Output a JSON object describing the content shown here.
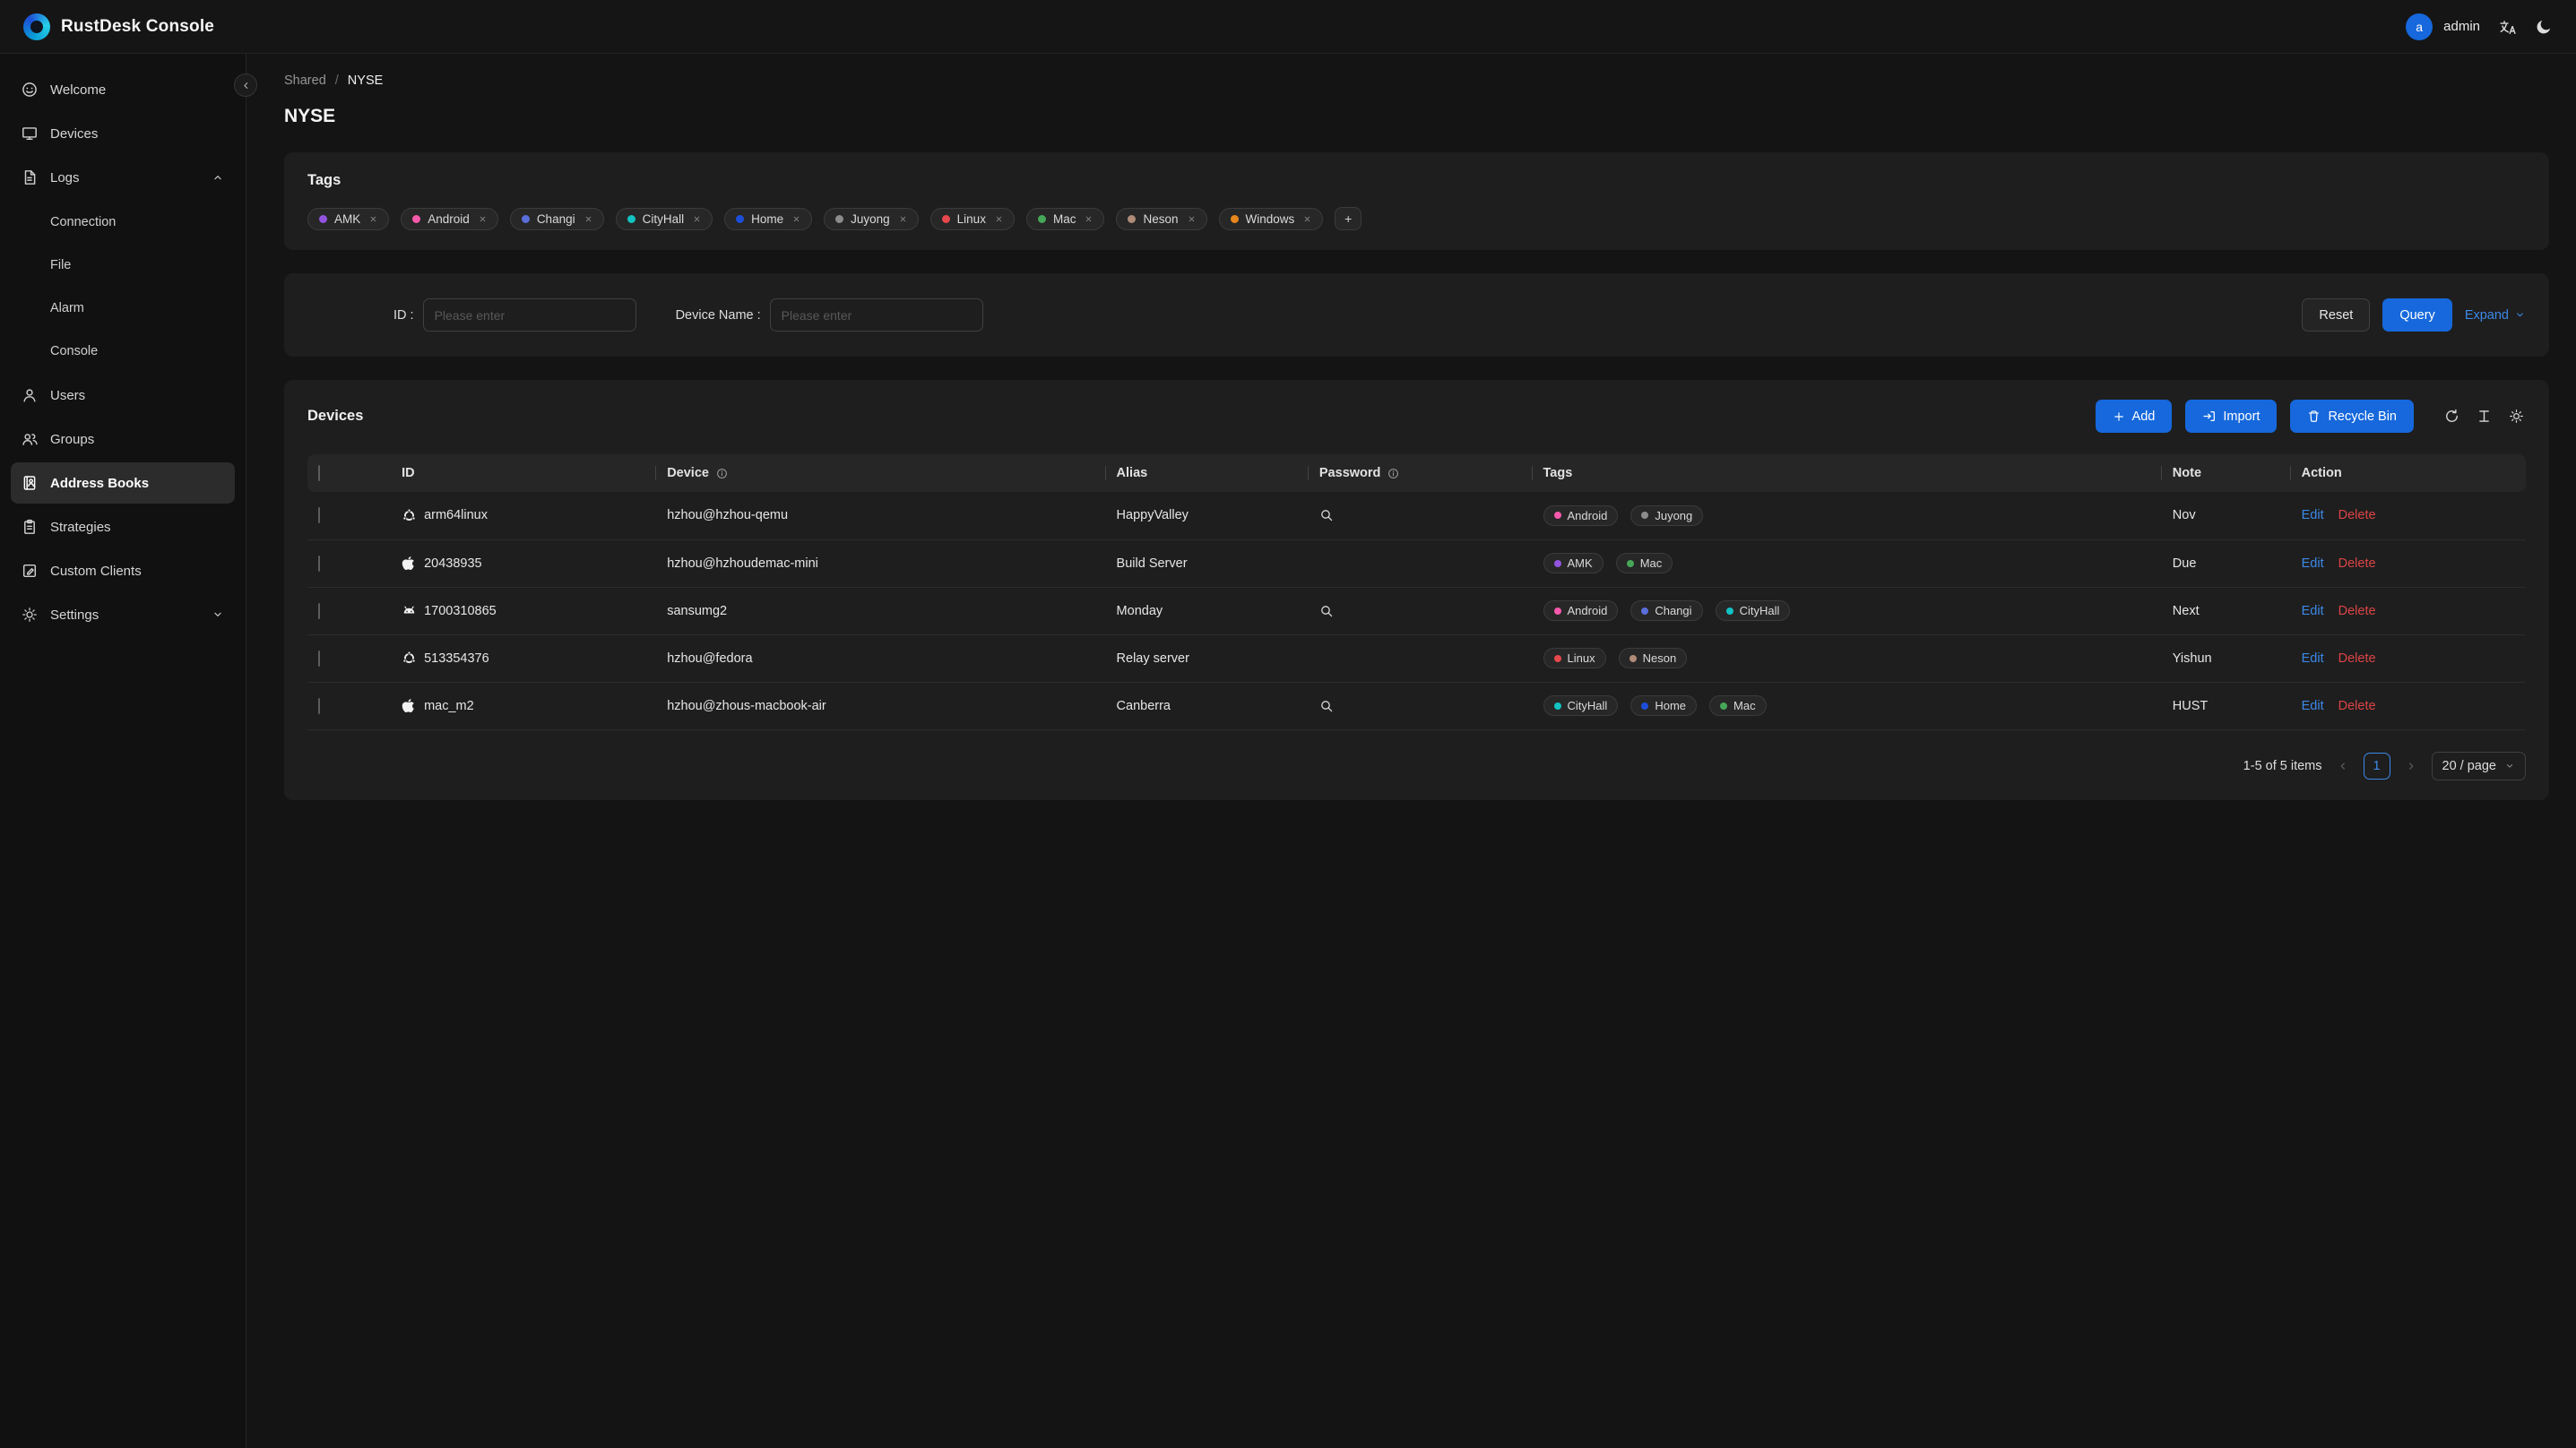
{
  "header": {
    "app_title": "RustDesk Console",
    "user_initial": "a",
    "user_name": "admin"
  },
  "sidebar": {
    "items": [
      {
        "label": "Welcome"
      },
      {
        "label": "Devices"
      },
      {
        "label": "Logs"
      },
      {
        "label": "Users"
      },
      {
        "label": "Groups"
      },
      {
        "label": "Address Books"
      },
      {
        "label": "Strategies"
      },
      {
        "label": "Custom Clients"
      },
      {
        "label": "Settings"
      }
    ],
    "logs_children": [
      {
        "label": "Connection"
      },
      {
        "label": "File"
      },
      {
        "label": "Alarm"
      },
      {
        "label": "Console"
      }
    ]
  },
  "breadcrumb": {
    "root": "Shared",
    "separator": "/",
    "current": "NYSE"
  },
  "page": {
    "title": "NYSE"
  },
  "tags_card": {
    "title": "Tags",
    "add_label": "+",
    "tags": [
      {
        "label": "AMK",
        "color": "#9254de"
      },
      {
        "label": "Android",
        "color": "#f759ab"
      },
      {
        "label": "Changi",
        "color": "#5a6fdb"
      },
      {
        "label": "CityHall",
        "color": "#13c2c2"
      },
      {
        "label": "Home",
        "color": "#1d4ed8"
      },
      {
        "label": "Juyong",
        "color": "#8c8c8c"
      },
      {
        "label": "Linux",
        "color": "#e5484d"
      },
      {
        "label": "Mac",
        "color": "#46a758"
      },
      {
        "label": "Neson",
        "color": "#b08b78"
      },
      {
        "label": "Windows",
        "color": "#e8871e"
      }
    ]
  },
  "filter_card": {
    "id_label": "ID :",
    "id_placeholder": "Please enter",
    "device_label": "Device Name :",
    "device_placeholder": "Please enter",
    "reset_label": "Reset",
    "query_label": "Query",
    "expand_label": "Expand"
  },
  "devices_card": {
    "title": "Devices",
    "toolbar": {
      "add": "Add",
      "import": "Import",
      "recycle_bin": "Recycle Bin"
    },
    "columns": {
      "id": "ID",
      "device": "Device",
      "alias": "Alias",
      "password": "Password",
      "tags": "Tags",
      "note": "Note",
      "action": "Action"
    },
    "actions": {
      "edit": "Edit",
      "delete": "Delete"
    },
    "rows": [
      {
        "os": "ubuntu",
        "id": "arm64linux",
        "device": "hzhou@hzhou-qemu",
        "alias": "HappyValley",
        "has_password": true,
        "tags": [
          {
            "label": "Android",
            "color": "#f759ab"
          },
          {
            "label": "Juyong",
            "color": "#8c8c8c"
          }
        ],
        "note": "Nov"
      },
      {
        "os": "apple",
        "id": "20438935",
        "device": "hzhou@hzhoudemac-mini",
        "alias": "Build Server",
        "has_password": false,
        "tags": [
          {
            "label": "AMK",
            "color": "#9254de"
          },
          {
            "label": "Mac",
            "color": "#46a758"
          }
        ],
        "note": "Due"
      },
      {
        "os": "android",
        "id": "1700310865",
        "device": "sansumg2",
        "alias": "Monday",
        "has_password": true,
        "tags": [
          {
            "label": "Android",
            "color": "#f759ab"
          },
          {
            "label": "Changi",
            "color": "#5a6fdb"
          },
          {
            "label": "CityHall",
            "color": "#13c2c2"
          }
        ],
        "note": "Next"
      },
      {
        "os": "ubuntu",
        "id": "513354376",
        "device": "hzhou@fedora",
        "alias": "Relay server",
        "has_password": false,
        "tags": [
          {
            "label": "Linux",
            "color": "#e5484d"
          },
          {
            "label": "Neson",
            "color": "#b08b78"
          }
        ],
        "note": "Yishun"
      },
      {
        "os": "apple",
        "id": "mac_m2",
        "device": "hzhou@zhous-macbook-air",
        "alias": "Canberra",
        "has_password": true,
        "tags": [
          {
            "label": "CityHall",
            "color": "#13c2c2"
          },
          {
            "label": "Home",
            "color": "#1d4ed8"
          },
          {
            "label": "Mac",
            "color": "#46a758"
          }
        ],
        "note": "HUST"
      }
    ],
    "pagination": {
      "summary": "1-5 of 5 items",
      "current_page": "1",
      "page_size": "20 / page"
    }
  },
  "colors": {
    "primary": "#1668dc",
    "link": "#3c89e8",
    "danger": "#dc4446"
  }
}
